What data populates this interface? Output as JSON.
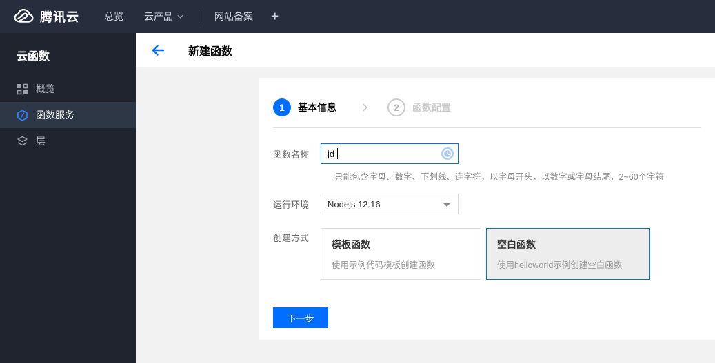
{
  "topnav": {
    "brand": "腾讯云",
    "overview": "总览",
    "products": "云产品",
    "beian": "网站备案",
    "plus": "+"
  },
  "sidebar": {
    "title": "云函数",
    "items": [
      {
        "label": "概览",
        "icon": "grid-icon",
        "selected": false
      },
      {
        "label": "函数服务",
        "icon": "function-service-icon",
        "selected": true
      },
      {
        "label": "层",
        "icon": "layers-icon",
        "selected": false
      }
    ]
  },
  "header": {
    "title": "新建函数"
  },
  "steps": [
    {
      "number": "1",
      "label": "基本信息",
      "active": true
    },
    {
      "number": "2",
      "label": "函数配置",
      "active": false
    }
  ],
  "form": {
    "name_label": "函数名称",
    "name_value": "jd",
    "name_hint": "只能包含字母、数字、下划线、连字符，以字母开头，以数字或字母结尾，2~60个字符",
    "runtime_label": "运行环境",
    "runtime_value": "Nodejs 12.16",
    "method_label": "创建方式",
    "methods": [
      {
        "title": "模板函数",
        "desc": "使用示例代码模板创建函数",
        "selected": false
      },
      {
        "title": "空白函数",
        "desc": "使用helloworld示例创建空白函数",
        "selected": true
      }
    ],
    "next_button": "下一步"
  },
  "colors": {
    "accent_blue": "#006eff",
    "topnav_bg": "#262d3c",
    "sidebar_bg": "#1f242e",
    "sidebar_selected_bg": "#2e3745",
    "content_bg": "#f2f2f2",
    "selected_card_bg": "#ededed"
  }
}
